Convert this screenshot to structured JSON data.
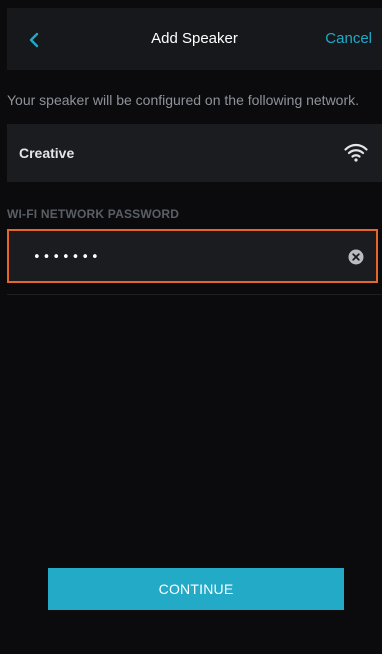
{
  "header": {
    "back_icon": "chevron-left-icon",
    "title": "Add Speaker",
    "cancel_label": "Cancel"
  },
  "info_text": "Your speaker will be configured on the following network.",
  "network": {
    "name": "Creative",
    "icon": "wifi-icon"
  },
  "password": {
    "section_label": "WI-FI NETWORK PASSWORD",
    "value": "•••••••",
    "clear_icon": "clear-icon"
  },
  "continue_label": "CONTINUE",
  "colors": {
    "accent": "#23aac7",
    "focus_border": "#e3672a",
    "background": "#0b0b0d",
    "panel": "#1a1c20"
  }
}
